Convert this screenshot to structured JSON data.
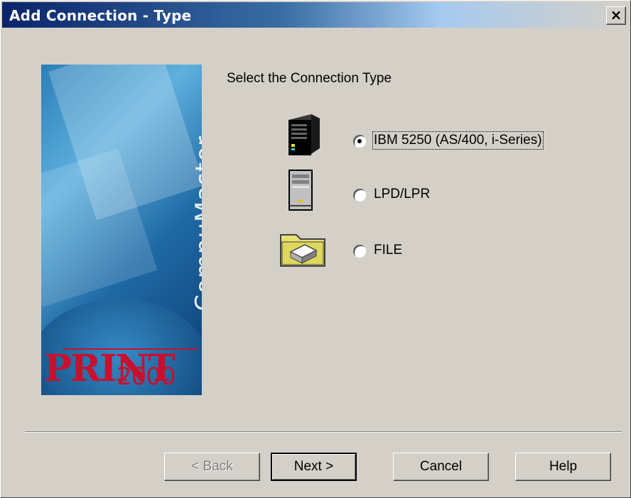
{
  "window": {
    "title": "Add Connection - Type",
    "close_label": "×"
  },
  "banner": {
    "product_name": "CompuMaster",
    "logo_print": "PRINT",
    "logo_year": "2000"
  },
  "main": {
    "heading": "Select the Connection Type",
    "options": [
      {
        "label": "IBM 5250 (AS/400, i-Series)",
        "selected": true,
        "icon": "server-tower-black-icon"
      },
      {
        "label": "LPD/LPR",
        "selected": false,
        "icon": "computer-tower-grey-icon"
      },
      {
        "label": "FILE",
        "selected": false,
        "icon": "folder-printer-icon"
      }
    ]
  },
  "buttons": {
    "back": "< Back",
    "next": "Next >",
    "cancel": "Cancel",
    "help": "Help"
  }
}
